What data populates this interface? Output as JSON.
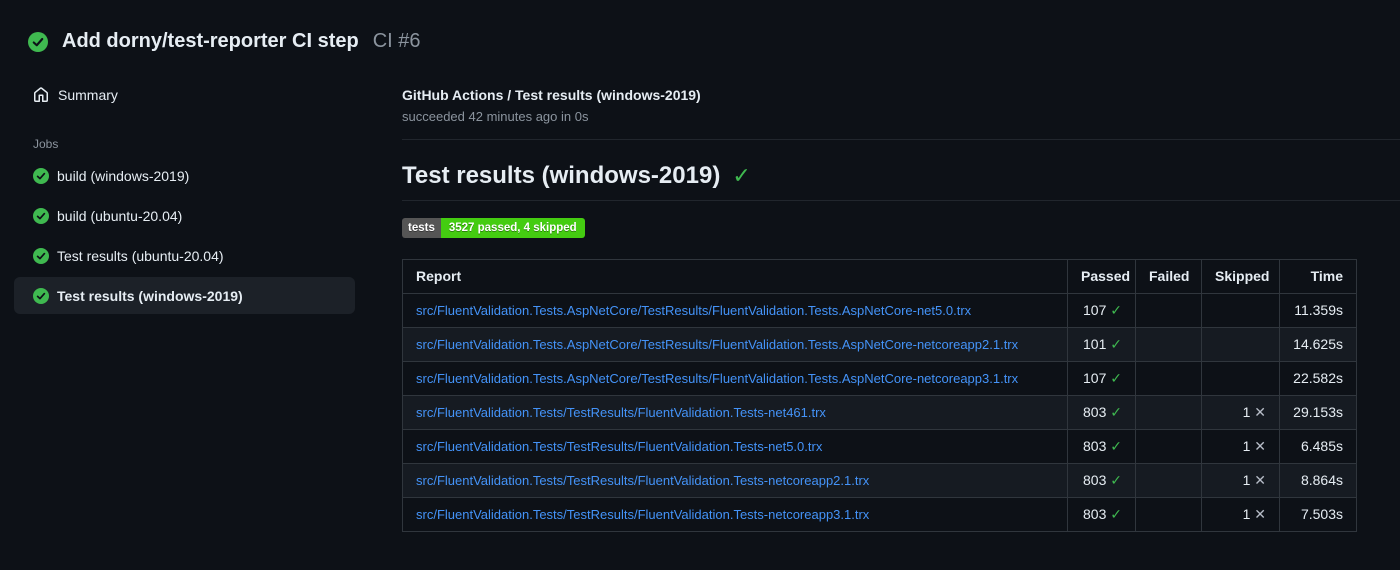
{
  "header": {
    "title": "Add dorny/test-reporter CI step",
    "run_number": "CI #6"
  },
  "sidebar": {
    "summary_label": "Summary",
    "jobs_label": "Jobs",
    "jobs": [
      {
        "label": "build (windows-2019)",
        "selected": false
      },
      {
        "label": "build (ubuntu-20.04)",
        "selected": false
      },
      {
        "label": "Test results (ubuntu-20.04)",
        "selected": false
      },
      {
        "label": "Test results (windows-2019)",
        "selected": true
      }
    ]
  },
  "main": {
    "run_title": "GitHub Actions / Test results (windows-2019)",
    "run_status": "succeeded 42 minutes ago in 0s",
    "section_title": "Test results (windows-2019)",
    "badge": {
      "label": "tests",
      "value": "3527 passed, 4 skipped",
      "label_bg": "#555555",
      "value_bg": "#44cc11"
    },
    "table": {
      "headers": [
        "Report",
        "Passed",
        "Failed",
        "Skipped",
        "Time"
      ],
      "rows": [
        {
          "report": "src/FluentValidation.Tests.AspNetCore/TestResults/FluentValidation.Tests.AspNetCore-net5.0.trx",
          "passed": "107",
          "failed": "",
          "skipped": "",
          "time": "11.359s"
        },
        {
          "report": "src/FluentValidation.Tests.AspNetCore/TestResults/FluentValidation.Tests.AspNetCore-netcoreapp2.1.trx",
          "passed": "101",
          "failed": "",
          "skipped": "",
          "time": "14.625s"
        },
        {
          "report": "src/FluentValidation.Tests.AspNetCore/TestResults/FluentValidation.Tests.AspNetCore-netcoreapp3.1.trx",
          "passed": "107",
          "failed": "",
          "skipped": "",
          "time": "22.582s"
        },
        {
          "report": "src/FluentValidation.Tests/TestResults/FluentValidation.Tests-net461.trx",
          "passed": "803",
          "failed": "",
          "skipped": "1",
          "time": "29.153s"
        },
        {
          "report": "src/FluentValidation.Tests/TestResults/FluentValidation.Tests-net5.0.trx",
          "passed": "803",
          "failed": "",
          "skipped": "1",
          "time": "6.485s"
        },
        {
          "report": "src/FluentValidation.Tests/TestResults/FluentValidation.Tests-netcoreapp2.1.trx",
          "passed": "803",
          "failed": "",
          "skipped": "1",
          "time": "8.864s"
        },
        {
          "report": "src/FluentValidation.Tests/TestResults/FluentValidation.Tests-netcoreapp3.1.trx",
          "passed": "803",
          "failed": "",
          "skipped": "1",
          "time": "7.503s"
        }
      ]
    }
  },
  "icons": {
    "success_check": "✓",
    "skip_cross": "✕"
  },
  "colors": {
    "background": "#0d1117",
    "row_alternate": "#161b22",
    "table_border": "#30363d",
    "link_accent": "#4493f8",
    "success_green": "#3fb950",
    "badge_label_bg": "#555555",
    "badge_value_bg": "#44cc11"
  }
}
